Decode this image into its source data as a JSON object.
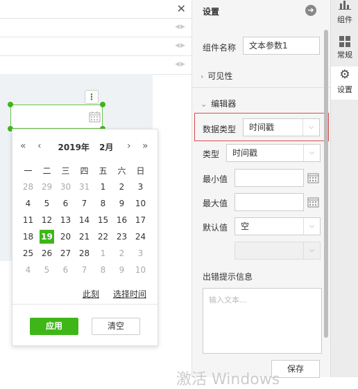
{
  "left_rows": 3,
  "calendar": {
    "year_label": "2019年",
    "month_label": "2月",
    "prev_year": "«",
    "prev_month": "‹",
    "next_month": "›",
    "next_year": "»",
    "weekdays": [
      "一",
      "二",
      "三",
      "四",
      "五",
      "六",
      "日"
    ],
    "weeks": [
      [
        {
          "d": "28",
          "dim": true
        },
        {
          "d": "29",
          "dim": true
        },
        {
          "d": "30",
          "dim": true
        },
        {
          "d": "31",
          "dim": true
        },
        {
          "d": "1"
        },
        {
          "d": "2"
        },
        {
          "d": "3"
        }
      ],
      [
        {
          "d": "4"
        },
        {
          "d": "5"
        },
        {
          "d": "6"
        },
        {
          "d": "7"
        },
        {
          "d": "8"
        },
        {
          "d": "9"
        },
        {
          "d": "10"
        }
      ],
      [
        {
          "d": "11"
        },
        {
          "d": "12"
        },
        {
          "d": "13"
        },
        {
          "d": "14"
        },
        {
          "d": "15"
        },
        {
          "d": "16"
        },
        {
          "d": "17"
        }
      ],
      [
        {
          "d": "18"
        },
        {
          "d": "19",
          "sel": true
        },
        {
          "d": "20"
        },
        {
          "d": "21"
        },
        {
          "d": "22"
        },
        {
          "d": "23"
        },
        {
          "d": "24"
        }
      ],
      [
        {
          "d": "25"
        },
        {
          "d": "26"
        },
        {
          "d": "27"
        },
        {
          "d": "28"
        },
        {
          "d": "1",
          "dim": true
        },
        {
          "d": "2",
          "dim": true
        },
        {
          "d": "3",
          "dim": true
        }
      ],
      [
        {
          "d": "4",
          "dim": true
        },
        {
          "d": "5",
          "dim": true
        },
        {
          "d": "6",
          "dim": true
        },
        {
          "d": "7",
          "dim": true
        },
        {
          "d": "8",
          "dim": true
        },
        {
          "d": "9",
          "dim": true
        },
        {
          "d": "10",
          "dim": true
        }
      ]
    ],
    "now_link": "此刻",
    "choose_time_link": "选择时间",
    "apply": "应用",
    "clear": "清空"
  },
  "panel": {
    "title": "设置",
    "component_name_label": "组件名称",
    "component_name_value": "文本参数1",
    "visibility": "可见性",
    "editor": "编辑器",
    "data_type_label": "数据类型",
    "data_type_value": "时间戳",
    "type_label": "类型",
    "type_value": "时间戳",
    "min_label": "最小值",
    "max_label": "最大值",
    "default_label": "默认值",
    "default_value": "空",
    "error_label": "出错提示信息",
    "error_placeholder": "输入文本...",
    "save": "保存"
  },
  "sidebar": {
    "items": [
      {
        "label": "组件",
        "icon": "bar-chart-icon"
      },
      {
        "label": "常规",
        "icon": "grid-icon"
      },
      {
        "label": "设置",
        "icon": "gear-icon"
      }
    ]
  },
  "watermark": "激活 Windows",
  "colors": {
    "accent": "#3fb618",
    "highlight_border": "#e04848"
  }
}
